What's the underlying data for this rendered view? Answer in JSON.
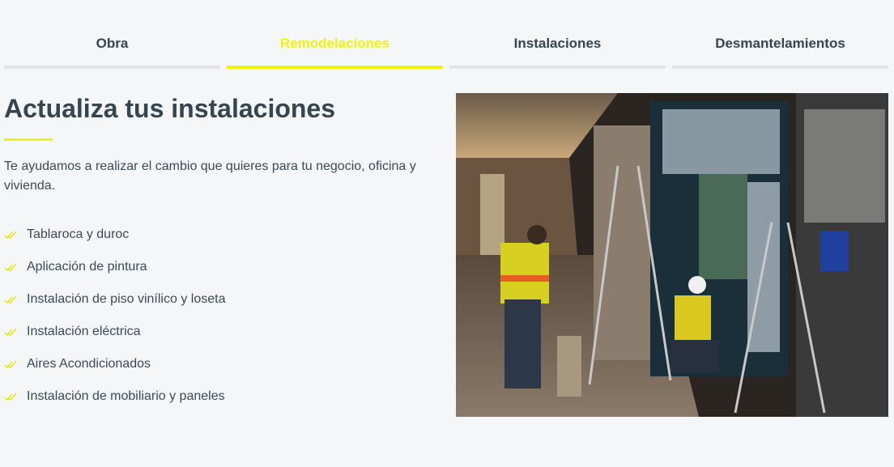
{
  "tabs": [
    {
      "label": "Obra",
      "active": false
    },
    {
      "label": "Remodelaciones",
      "active": true
    },
    {
      "label": "Instalaciones",
      "active": false
    },
    {
      "label": "Desmantelamientos",
      "active": false
    }
  ],
  "section": {
    "title": "Actualiza tus instalaciones",
    "intro": "Te ayudamos a realizar el cambio que quieres para tu negocio, oficina y vivienda.",
    "items": [
      "Tablaroca y duroc",
      "Aplicación de pintura",
      "Instalación de piso vinílico y loseta",
      "Instalación eléctrica",
      "Aires Acondicionados",
      "Instalación de mobiliario y paneles"
    ],
    "bullet_icon": "double-check-icon"
  },
  "colors": {
    "accent": "#f2f20c",
    "text": "#36454f",
    "background": "#f4f6f8",
    "tab_underline": "#e2e4e6"
  }
}
